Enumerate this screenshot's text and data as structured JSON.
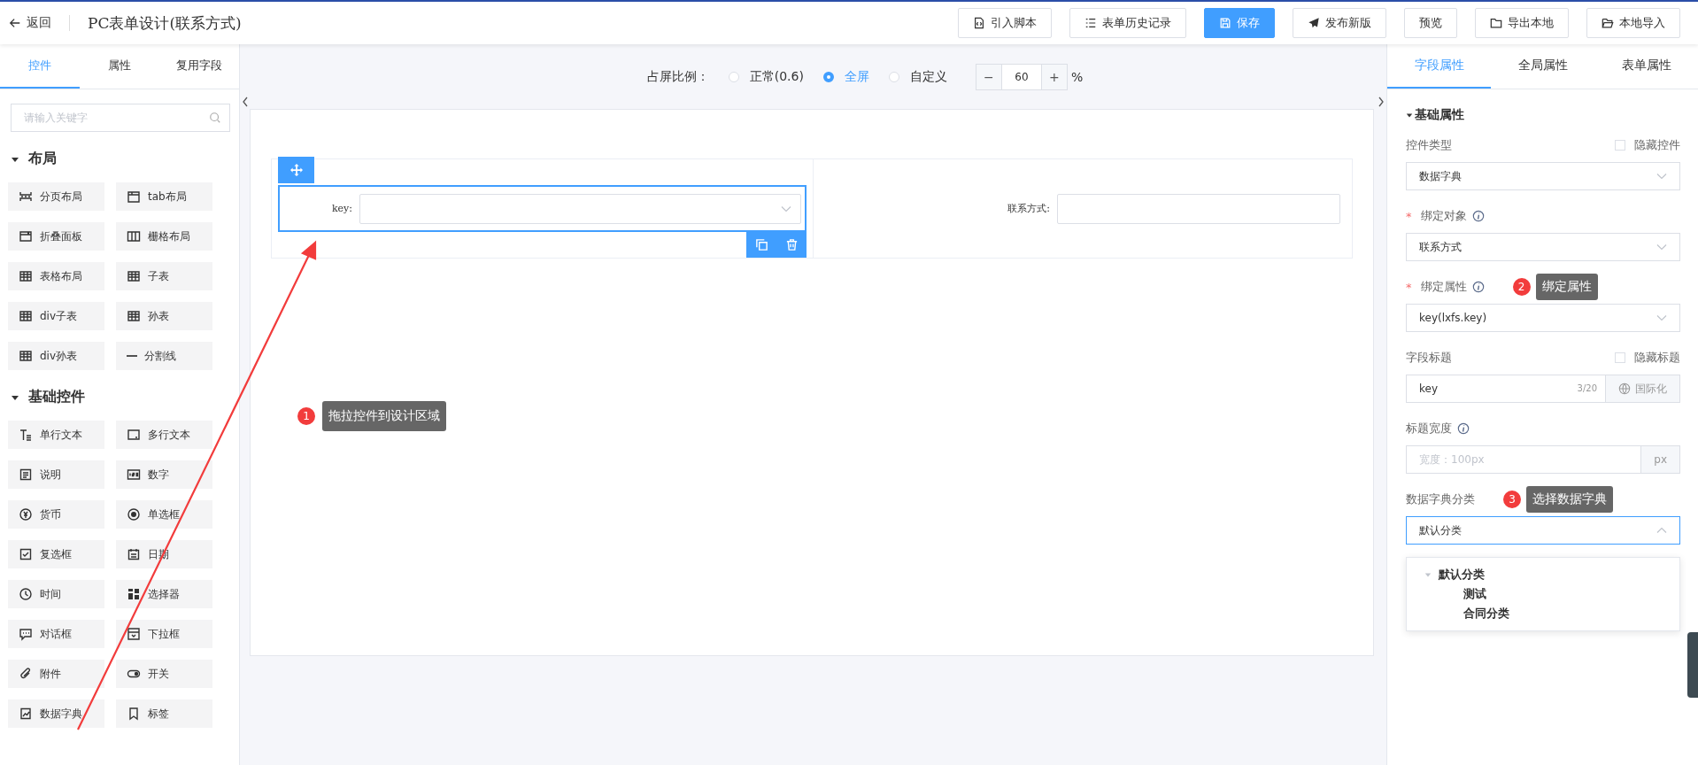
{
  "header": {
    "back": "返回",
    "title": "PC表单设计(联系方式)",
    "buttons": [
      {
        "label": "引入脚本",
        "kind": "script",
        "primary": false
      },
      {
        "label": "表单历史记录",
        "kind": "history",
        "primary": false
      },
      {
        "label": "保存",
        "kind": "save",
        "primary": true
      },
      {
        "label": "发布新版",
        "kind": "publish",
        "primary": false
      },
      {
        "label": "预览",
        "kind": "preview",
        "primary": false
      },
      {
        "label": "导出本地",
        "kind": "export",
        "primary": false
      },
      {
        "label": "本地导入",
        "kind": "import",
        "primary": false
      }
    ]
  },
  "left_panel": {
    "tabs": [
      {
        "label": "控件",
        "selected": true
      },
      {
        "label": "属性",
        "selected": false
      },
      {
        "label": "复用字段",
        "selected": false
      }
    ],
    "search": {
      "placeholder": "请输入关键字"
    },
    "groups": [
      {
        "title": "布局",
        "expanded": true,
        "items": [
          {
            "label": "分页布局",
            "kind": "paging"
          },
          {
            "label": "tab布局",
            "kind": "tab"
          },
          {
            "label": "折叠面板",
            "kind": "collapse"
          },
          {
            "label": "栅格布局",
            "kind": "columns"
          },
          {
            "label": "表格布局",
            "kind": "table"
          },
          {
            "label": "子表",
            "kind": "table"
          },
          {
            "label": "div子表",
            "kind": "table"
          },
          {
            "label": "孙表",
            "kind": "table"
          },
          {
            "label": "div孙表",
            "kind": "table"
          },
          {
            "label": "分割线",
            "kind": "divider"
          }
        ]
      },
      {
        "title": "基础控件",
        "expanded": true,
        "items": [
          {
            "label": "单行文本",
            "kind": "text"
          },
          {
            "label": "多行文本",
            "kind": "textarea"
          },
          {
            "label": "说明",
            "kind": "note"
          },
          {
            "label": "数字",
            "kind": "number"
          },
          {
            "label": "货币",
            "kind": "currency"
          },
          {
            "label": "单选框",
            "kind": "radio"
          },
          {
            "label": "复选框",
            "kind": "checkbox"
          },
          {
            "label": "日期",
            "kind": "date"
          },
          {
            "label": "时间",
            "kind": "time"
          },
          {
            "label": "选择器",
            "kind": "selector"
          },
          {
            "label": "对话框",
            "kind": "dialog"
          },
          {
            "label": "下拉框",
            "kind": "dropdown"
          },
          {
            "label": "附件",
            "kind": "attachment"
          },
          {
            "label": "开关",
            "kind": "switch"
          },
          {
            "label": "数据字典",
            "kind": "dictionary"
          },
          {
            "label": "标签",
            "kind": "tag"
          }
        ]
      }
    ]
  },
  "ratio": {
    "label": "占屏比例：",
    "options": [
      {
        "label": "正常(0.6)",
        "selected": false
      },
      {
        "label": "全屏",
        "selected": true
      },
      {
        "label": "自定义",
        "selected": false
      }
    ],
    "minus": "−",
    "value": "60",
    "plus": "+",
    "unit": "%"
  },
  "canvas": {
    "fields": [
      {
        "label": "key:",
        "kind": "select",
        "selected": true
      },
      {
        "label": "联系方式:",
        "kind": "input",
        "selected": false
      }
    ],
    "annotation": {
      "number": "1",
      "text": "拖拉控件到设计区域"
    }
  },
  "right_panel": {
    "tabs": [
      {
        "label": "字段属性",
        "selected": true
      },
      {
        "label": "全局属性",
        "selected": false
      },
      {
        "label": "表单属性",
        "selected": false
      }
    ],
    "section": {
      "title": "基础属性",
      "expanded": true
    },
    "fields": [
      {
        "kind": "select",
        "label": "控件类型",
        "info": false,
        "value": "数据字典",
        "checkbox": {
          "label": "隐藏控件",
          "checked": false
        }
      },
      {
        "kind": "select",
        "label": "绑定对象",
        "required_mark": "*",
        "info": true,
        "value": "联系方式"
      },
      {
        "kind": "select",
        "label": "绑定属性",
        "required_mark": "*",
        "info": true,
        "value": "key(lxfs.key)",
        "annotation": {
          "number": "2",
          "text": "绑定属性"
        }
      },
      {
        "kind": "input",
        "label": "字段标题",
        "info": false,
        "value": "key",
        "counter": "3/20",
        "addon": {
          "label": "国际化",
          "kind": "button"
        },
        "checkbox": {
          "label": "隐藏标题",
          "checked": false
        }
      },
      {
        "kind": "input",
        "label": "标题宽度",
        "info": true,
        "placeholder": "宽度：100px",
        "addon": {
          "label": "px",
          "kind": "unit"
        }
      },
      {
        "kind": "select",
        "label": "数据字典分类",
        "info": false,
        "value": "默认分类",
        "expanded": true,
        "annotation": {
          "number": "3",
          "text": "选择数据字典"
        },
        "options": [
          {
            "label": "默认分类",
            "expanded": true,
            "children": [
              {
                "label": "测试"
              },
              {
                "label": "合同分类"
              }
            ]
          }
        ]
      }
    ]
  }
}
